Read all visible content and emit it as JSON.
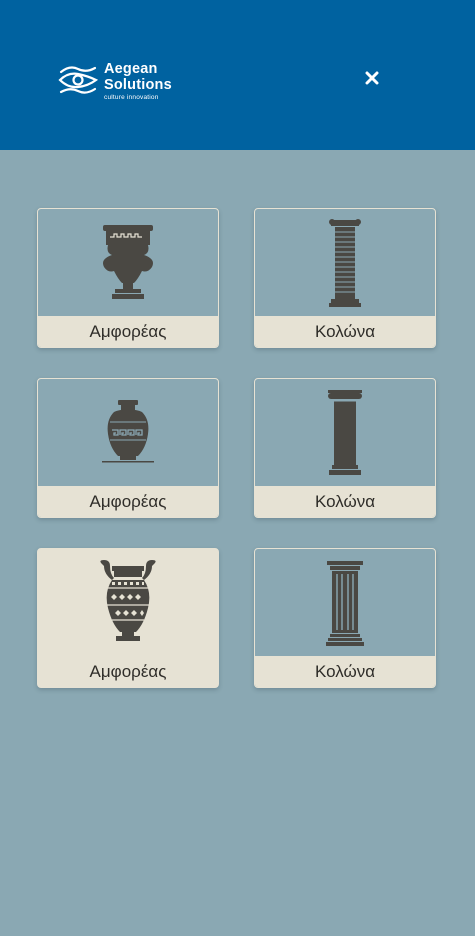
{
  "header": {
    "brand_line1": "Aegean",
    "brand_line2": "Solutions",
    "brand_tagline": "culture innovation",
    "close_icon": "close-icon",
    "background_color": "#0062a0"
  },
  "page": {
    "background_color": "#8aa8b3"
  },
  "cards": [
    {
      "label": "Αμφορέας",
      "icon": "krater-icon",
      "selected": false
    },
    {
      "label": "Κολώνα",
      "icon": "banded-column-icon",
      "selected": false
    },
    {
      "label": "Αμφορέας",
      "icon": "meander-vase-icon",
      "selected": false
    },
    {
      "label": "Κολώνα",
      "icon": "ionic-column-icon",
      "selected": false
    },
    {
      "label": "Αμφορέας",
      "icon": "handled-amphora-icon",
      "selected": true
    },
    {
      "label": "Κολώνα",
      "icon": "fluted-column-icon",
      "selected": false
    }
  ],
  "colors": {
    "card_label_bg": "#e6e2d4",
    "icon_fill": "#4a4843"
  }
}
